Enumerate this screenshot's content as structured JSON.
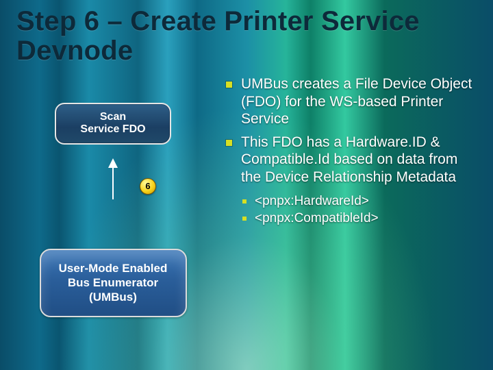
{
  "title": "Step 6 – Create Printer Service Devnode",
  "diagram": {
    "top_node": "Scan\nService FDO",
    "step_number": "6",
    "bottom_node": "User-Mode Enabled\nBus Enumerator\n(UMBus)"
  },
  "bullets": {
    "items": [
      "UMBus creates a File Device Object (FDO) for the WS-based Printer Service",
      "This FDO has a Hardware.ID & Compatible.Id based on data from the Device Relationship Metadata"
    ],
    "sub_items": [
      "<pnpx:HardwareId>",
      "<pnpx:CompatibleId>"
    ]
  }
}
